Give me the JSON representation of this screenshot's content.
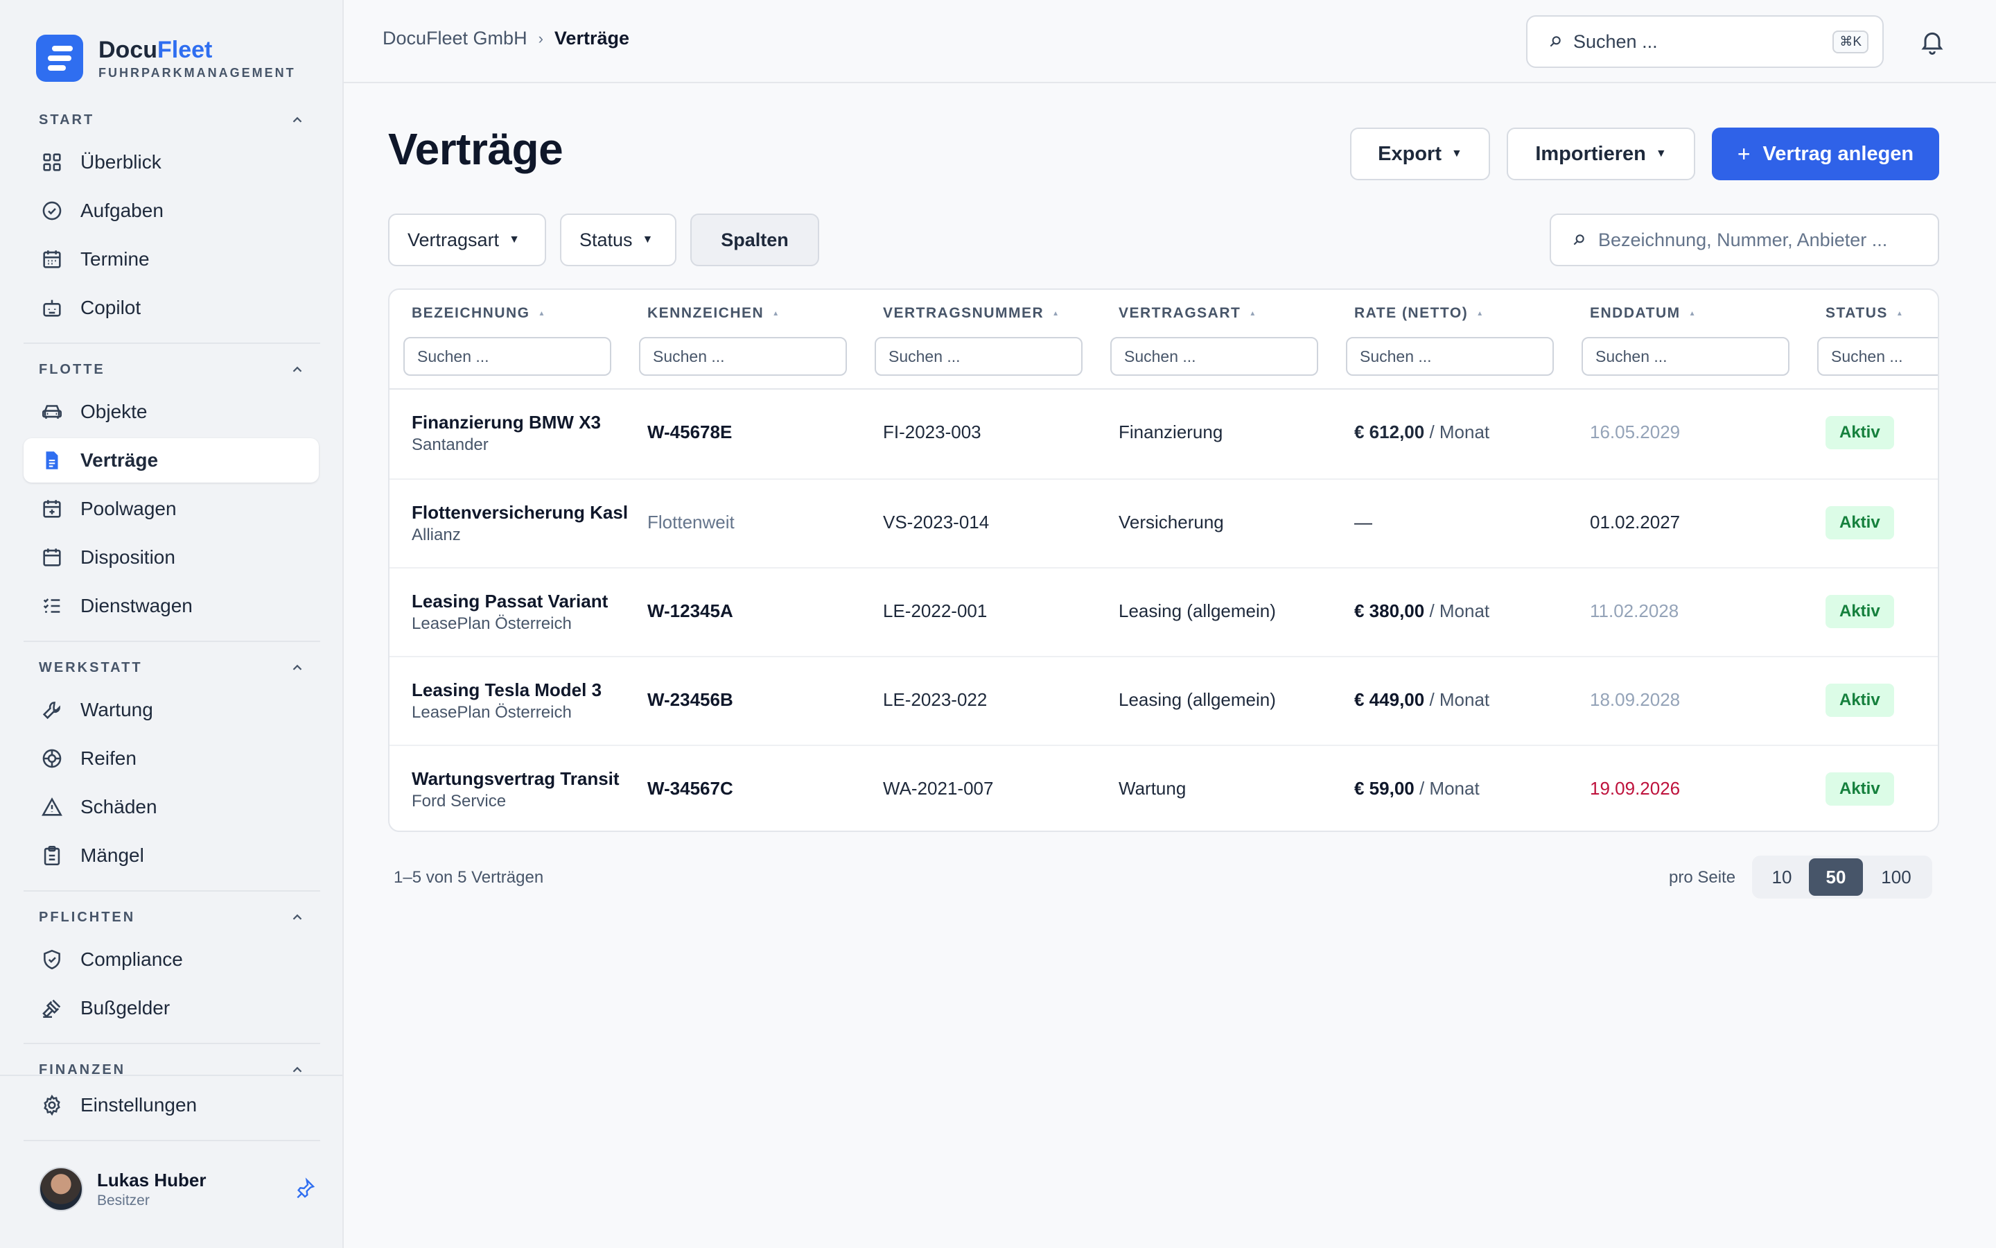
{
  "brand": {
    "name_prefix": "Docu",
    "name_accent": "Fleet",
    "subtitle": "FUHRPARKMANAGEMENT"
  },
  "sidebar": {
    "sections": [
      {
        "label": "START",
        "items": [
          {
            "label": "Überblick",
            "icon": "grid-icon"
          },
          {
            "label": "Aufgaben",
            "icon": "check-circle-icon"
          },
          {
            "label": "Termine",
            "icon": "calendar-icon"
          },
          {
            "label": "Copilot",
            "icon": "bot-icon"
          }
        ]
      },
      {
        "label": "FLOTTE",
        "items": [
          {
            "label": "Objekte",
            "icon": "car-icon"
          },
          {
            "label": "Verträge",
            "icon": "document-icon",
            "active": true
          },
          {
            "label": "Poolwagen",
            "icon": "calendar-plus-icon"
          },
          {
            "label": "Disposition",
            "icon": "calendar-icon"
          },
          {
            "label": "Dienstwagen",
            "icon": "list-check-icon"
          }
        ]
      },
      {
        "label": "WERKSTATT",
        "items": [
          {
            "label": "Wartung",
            "icon": "wrench-icon"
          },
          {
            "label": "Reifen",
            "icon": "tire-icon"
          },
          {
            "label": "Schäden",
            "icon": "warning-icon"
          },
          {
            "label": "Mängel",
            "icon": "clipboard-icon"
          }
        ]
      },
      {
        "label": "PFLICHTEN",
        "items": [
          {
            "label": "Compliance",
            "icon": "shield-check-icon"
          },
          {
            "label": "Bußgelder",
            "icon": "gavel-icon"
          }
        ]
      },
      {
        "label": "FINANZEN",
        "items": []
      }
    ],
    "settings_label": "Einstellungen",
    "user": {
      "name": "Lukas Huber",
      "role": "Besitzer"
    }
  },
  "topbar": {
    "breadcrumb": [
      "DocuFleet GmbH",
      "Verträge"
    ],
    "breadcrumb_separator": "›",
    "search_placeholder": "Suchen ...",
    "search_shortcut": "⌘K"
  },
  "page": {
    "title": "Verträge",
    "export_label": "Export",
    "import_label": "Importieren",
    "create_label": "Vertrag anlegen",
    "filters": {
      "type": "Vertragsart",
      "status": "Status",
      "columns": "Spalten"
    },
    "table_search_placeholder": "Bezeichnung, Nummer, Anbieter ..."
  },
  "table": {
    "columns": [
      "BEZEICHNUNG",
      "KENNZEICHEN",
      "VERTRAGSNUMMER",
      "VERTRAGSART",
      "RATE (NETTO)",
      "ENDDATUM",
      "STATUS"
    ],
    "filter_placeholder": "Suchen ...",
    "rows": [
      {
        "title": "Finanzierung BMW X3",
        "provider": "Santander",
        "plate": "W-45678E",
        "number": "FI-2023-003",
        "type": "Finanzierung",
        "rate": "€ 612,00",
        "rate_unit": " / Monat",
        "end": "16.05.2029",
        "status": "Aktiv"
      },
      {
        "title": "Flottenversicherung Kasl",
        "provider": "Allianz",
        "plate": "Flottenweit",
        "number": "VS-2023-014",
        "type": "Versicherung",
        "rate": "—",
        "rate_unit": "",
        "end": "01.02.2027",
        "status": "Aktiv"
      },
      {
        "title": "Leasing Passat Variant",
        "provider": "LeasePlan Österreich",
        "plate": "W-12345A",
        "number": "LE-2022-001",
        "type": "Leasing (allgemein)",
        "rate": "€ 380,00",
        "rate_unit": " / Monat",
        "end": "11.02.2028",
        "status": "Aktiv"
      },
      {
        "title": "Leasing Tesla Model 3",
        "provider": "LeasePlan Österreich",
        "plate": "W-23456B",
        "number": "LE-2023-022",
        "type": "Leasing (allgemein)",
        "rate": "€ 449,00",
        "rate_unit": " / Monat",
        "end": "18.09.2028",
        "status": "Aktiv"
      },
      {
        "title": "Wartungsvertrag Transit",
        "provider": "Ford Service",
        "plate": "W-34567C",
        "number": "WA-2021-007",
        "type": "Wartung",
        "rate": "€ 59,00",
        "rate_unit": " / Monat",
        "end": "19.09.2026",
        "status": "Aktiv"
      }
    ]
  },
  "footer": {
    "summary": "1–5 von 5 Verträgen",
    "per_page_label": "pro Seite",
    "per_page_options": [
      "10",
      "50",
      "100"
    ],
    "per_page_selected": "50"
  },
  "colors": {
    "accent": "#2f6ef0",
    "primary_button": "#2f62e8",
    "active_badge_bg": "#dcfce7",
    "active_badge_text": "#15803d",
    "overdue_date": "#be123c"
  }
}
